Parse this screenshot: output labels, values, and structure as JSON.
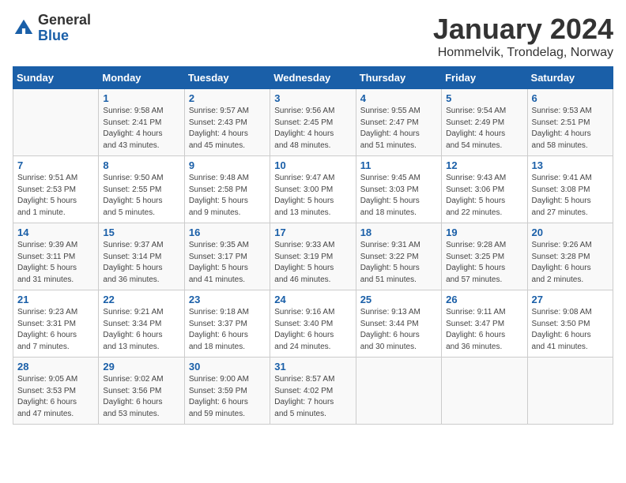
{
  "logo": {
    "general": "General",
    "blue": "Blue"
  },
  "header": {
    "title": "January 2024",
    "subtitle": "Hommelvik, Trondelag, Norway"
  },
  "weekdays": [
    "Sunday",
    "Monday",
    "Tuesday",
    "Wednesday",
    "Thursday",
    "Friday",
    "Saturday"
  ],
  "weeks": [
    [
      null,
      {
        "num": "1",
        "sunrise": "9:58 AM",
        "sunset": "2:41 PM",
        "daylight": "4 hours and 43 minutes."
      },
      {
        "num": "2",
        "sunrise": "9:57 AM",
        "sunset": "2:43 PM",
        "daylight": "4 hours and 45 minutes."
      },
      {
        "num": "3",
        "sunrise": "9:56 AM",
        "sunset": "2:45 PM",
        "daylight": "4 hours and 48 minutes."
      },
      {
        "num": "4",
        "sunrise": "9:55 AM",
        "sunset": "2:47 PM",
        "daylight": "4 hours and 51 minutes."
      },
      {
        "num": "5",
        "sunrise": "9:54 AM",
        "sunset": "2:49 PM",
        "daylight": "4 hours and 54 minutes."
      },
      {
        "num": "6",
        "sunrise": "9:53 AM",
        "sunset": "2:51 PM",
        "daylight": "4 hours and 58 minutes."
      }
    ],
    [
      {
        "num": "7",
        "sunrise": "9:51 AM",
        "sunset": "2:53 PM",
        "daylight": "5 hours and 1 minute."
      },
      {
        "num": "8",
        "sunrise": "9:50 AM",
        "sunset": "2:55 PM",
        "daylight": "5 hours and 5 minutes."
      },
      {
        "num": "9",
        "sunrise": "9:48 AM",
        "sunset": "2:58 PM",
        "daylight": "5 hours and 9 minutes."
      },
      {
        "num": "10",
        "sunrise": "9:47 AM",
        "sunset": "3:00 PM",
        "daylight": "5 hours and 13 minutes."
      },
      {
        "num": "11",
        "sunrise": "9:45 AM",
        "sunset": "3:03 PM",
        "daylight": "5 hours and 18 minutes."
      },
      {
        "num": "12",
        "sunrise": "9:43 AM",
        "sunset": "3:06 PM",
        "daylight": "5 hours and 22 minutes."
      },
      {
        "num": "13",
        "sunrise": "9:41 AM",
        "sunset": "3:08 PM",
        "daylight": "5 hours and 27 minutes."
      }
    ],
    [
      {
        "num": "14",
        "sunrise": "9:39 AM",
        "sunset": "3:11 PM",
        "daylight": "5 hours and 31 minutes."
      },
      {
        "num": "15",
        "sunrise": "9:37 AM",
        "sunset": "3:14 PM",
        "daylight": "5 hours and 36 minutes."
      },
      {
        "num": "16",
        "sunrise": "9:35 AM",
        "sunset": "3:17 PM",
        "daylight": "5 hours and 41 minutes."
      },
      {
        "num": "17",
        "sunrise": "9:33 AM",
        "sunset": "3:19 PM",
        "daylight": "5 hours and 46 minutes."
      },
      {
        "num": "18",
        "sunrise": "9:31 AM",
        "sunset": "3:22 PM",
        "daylight": "5 hours and 51 minutes."
      },
      {
        "num": "19",
        "sunrise": "9:28 AM",
        "sunset": "3:25 PM",
        "daylight": "5 hours and 57 minutes."
      },
      {
        "num": "20",
        "sunrise": "9:26 AM",
        "sunset": "3:28 PM",
        "daylight": "6 hours and 2 minutes."
      }
    ],
    [
      {
        "num": "21",
        "sunrise": "9:23 AM",
        "sunset": "3:31 PM",
        "daylight": "6 hours and 7 minutes."
      },
      {
        "num": "22",
        "sunrise": "9:21 AM",
        "sunset": "3:34 PM",
        "daylight": "6 hours and 13 minutes."
      },
      {
        "num": "23",
        "sunrise": "9:18 AM",
        "sunset": "3:37 PM",
        "daylight": "6 hours and 18 minutes."
      },
      {
        "num": "24",
        "sunrise": "9:16 AM",
        "sunset": "3:40 PM",
        "daylight": "6 hours and 24 minutes."
      },
      {
        "num": "25",
        "sunrise": "9:13 AM",
        "sunset": "3:44 PM",
        "daylight": "6 hours and 30 minutes."
      },
      {
        "num": "26",
        "sunrise": "9:11 AM",
        "sunset": "3:47 PM",
        "daylight": "6 hours and 36 minutes."
      },
      {
        "num": "27",
        "sunrise": "9:08 AM",
        "sunset": "3:50 PM",
        "daylight": "6 hours and 41 minutes."
      }
    ],
    [
      {
        "num": "28",
        "sunrise": "9:05 AM",
        "sunset": "3:53 PM",
        "daylight": "6 hours and 47 minutes."
      },
      {
        "num": "29",
        "sunrise": "9:02 AM",
        "sunset": "3:56 PM",
        "daylight": "6 hours and 53 minutes."
      },
      {
        "num": "30",
        "sunrise": "9:00 AM",
        "sunset": "3:59 PM",
        "daylight": "6 hours and 59 minutes."
      },
      {
        "num": "31",
        "sunrise": "8:57 AM",
        "sunset": "4:02 PM",
        "daylight": "7 hours and 5 minutes."
      },
      null,
      null,
      null
    ]
  ]
}
